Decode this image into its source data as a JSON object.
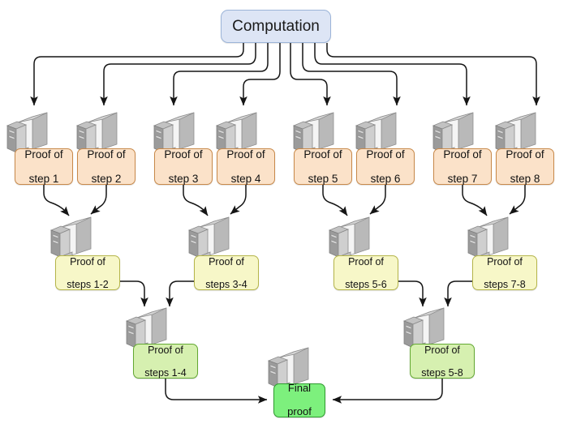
{
  "diagram": {
    "title_node": {
      "label": "Computation",
      "color": "#dde5f5"
    },
    "level1": [
      {
        "label_line1": "Proof of",
        "label_line2": "step 1"
      },
      {
        "label_line1": "Proof of",
        "label_line2": "step 2"
      },
      {
        "label_line1": "Proof of",
        "label_line2": "step 3"
      },
      {
        "label_line1": "Proof of",
        "label_line2": "step 4"
      },
      {
        "label_line1": "Proof of",
        "label_line2": "step 5"
      },
      {
        "label_line1": "Proof of",
        "label_line2": "step 6"
      },
      {
        "label_line1": "Proof of",
        "label_line2": "step 7"
      },
      {
        "label_line1": "Proof of",
        "label_line2": "step 8"
      }
    ],
    "level2": [
      {
        "label_line1": "Proof of",
        "label_line2": "steps 1-2"
      },
      {
        "label_line1": "Proof of",
        "label_line2": "steps 3-4"
      },
      {
        "label_line1": "Proof of",
        "label_line2": "steps 5-6"
      },
      {
        "label_line1": "Proof of",
        "label_line2": "steps 7-8"
      }
    ],
    "level3": [
      {
        "label_line1": "Proof of",
        "label_line2": "steps 1-4"
      },
      {
        "label_line1": "Proof of",
        "label_line2": "steps 5-8"
      }
    ],
    "final": {
      "label_line1": "Final",
      "label_line2": "proof"
    },
    "colors": {
      "computation_fill": "#dde5f5",
      "computation_stroke": "#9cb4d8",
      "step_fill": "#fbe2c9",
      "step_stroke": "#c8894a",
      "pair_fill": "#f7f7c8",
      "pair_stroke": "#b5b54a",
      "quad_fill": "#d6f0b0",
      "quad_stroke": "#63a832",
      "final_fill": "#7df07d",
      "final_stroke": "#2f9b2f",
      "edge_stroke": "#1a1a1a",
      "computer_tower": "#9d9d9d",
      "computer_monitor": "#e8e8e8"
    },
    "icons": {
      "node_icon": "computer-icon"
    }
  }
}
